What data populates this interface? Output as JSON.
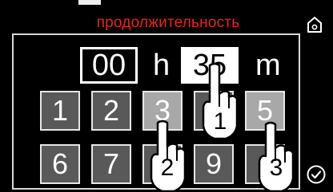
{
  "header": {
    "title": "продолжительность"
  },
  "icons": {
    "home": "home-icon",
    "confirm": "checkmark-circle-icon"
  },
  "time": {
    "hours": "00",
    "hours_unit": "h",
    "minutes": "35",
    "minutes_unit": "m"
  },
  "keypad": [
    {
      "label": "1",
      "state": "normal"
    },
    {
      "label": "2",
      "state": "normal"
    },
    {
      "label": "3",
      "state": "pressed"
    },
    {
      "label": "",
      "state": "normal"
    },
    {
      "label": "5",
      "state": "pressed"
    },
    {
      "label": "6",
      "state": "normal"
    },
    {
      "label": "7",
      "state": "normal"
    },
    {
      "label": "",
      "state": "normal"
    },
    {
      "label": "9",
      "state": "normal"
    },
    {
      "label": "",
      "state": "normal"
    }
  ],
  "steps": [
    "1",
    "2",
    "3"
  ],
  "colors": {
    "title": "#e8251d",
    "key": "#595959",
    "key_pressed": "#a8a8a8"
  }
}
